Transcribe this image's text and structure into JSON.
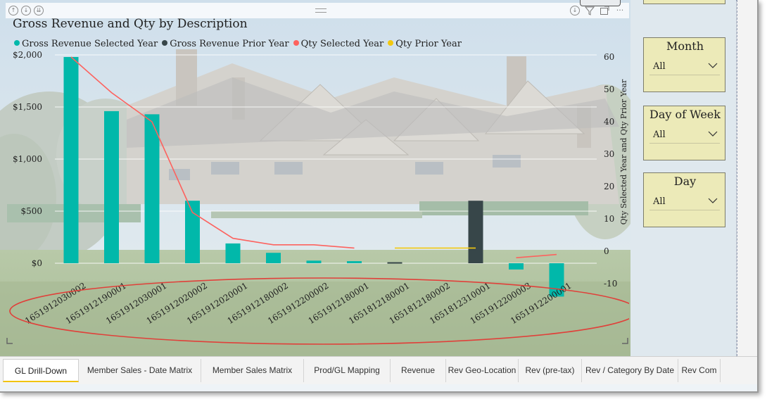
{
  "chart_data": {
    "type": "bar",
    "title": "Gross Revenue and Qty by Description",
    "categories": [
      "1651912030002",
      "1651912190001",
      "1651912030001",
      "1651912020002",
      "1651912020001",
      "1651912180002",
      "1651912200002",
      "1651912180001",
      "1651812180001",
      "1651812180002",
      "1651812310001",
      "1651912200003",
      "1651912200001"
    ],
    "series": [
      {
        "name": "Gross Revenue Selected Year",
        "axis": "left",
        "kind": "bar",
        "color": "#01b8aa",
        "values": [
          1980,
          1460,
          1430,
          600,
          190,
          100,
          25,
          20,
          null,
          null,
          null,
          -60,
          -320
        ]
      },
      {
        "name": "Gross Revenue Prior Year",
        "axis": "left",
        "kind": "bar",
        "color": "#374649",
        "values": [
          null,
          null,
          null,
          null,
          null,
          null,
          null,
          null,
          10,
          null,
          600,
          null,
          null
        ]
      },
      {
        "name": "Qty Selected Year",
        "axis": "right",
        "kind": "line",
        "color": "#fd625e",
        "values": [
          60,
          49,
          40,
          12,
          4,
          2,
          2,
          1,
          null,
          null,
          null,
          -2,
          -1
        ]
      },
      {
        "name": "Qty Prior Year",
        "axis": "right",
        "kind": "line",
        "color": "#f2c80f",
        "values": [
          null,
          null,
          null,
          null,
          null,
          null,
          null,
          null,
          1,
          1,
          1,
          null,
          null
        ]
      }
    ],
    "y_left": {
      "ylim": [
        -400,
        2000
      ],
      "ticks": [
        0,
        500,
        1000,
        1500,
        2000
      ],
      "tick_labels": [
        "$0",
        "$500",
        "$1,000",
        "$1,500",
        "$2,000"
      ]
    },
    "y_right": {
      "label": "Qty Selected Year and Qty Prior Year",
      "ylim": [
        -14,
        63
      ],
      "ticks": [
        -10,
        0,
        10,
        20,
        30,
        40,
        50,
        60
      ],
      "tick_labels": [
        "-10",
        "0",
        "10",
        "20",
        "30",
        "40",
        "50",
        "60"
      ]
    },
    "grid": true,
    "legend": "top-left"
  },
  "visual_header_icons": [
    "pin-icon",
    "drill-down-icon",
    "expand-icon",
    "drill-arrow-icon",
    "filter-icon",
    "focus-mode-icon",
    "more-options-icon"
  ],
  "highlight": {
    "shape": "ellipse",
    "color": "#e0403a"
  },
  "slicers": [
    {
      "title": "Month",
      "value": "All"
    },
    {
      "title": "Day of Week",
      "value": "All"
    },
    {
      "title": "Day",
      "value": "All"
    }
  ],
  "tabs": [
    "GL Drill-Down",
    "Member Sales - Date Matrix",
    "Member Sales Matrix",
    "Prod/GL Mapping",
    "Revenue",
    "Rev Geo-Location",
    "Rev (pre-tax)",
    "Rev / Category By Date",
    "Rev Com"
  ],
  "active_tab": "GL Drill-Down"
}
